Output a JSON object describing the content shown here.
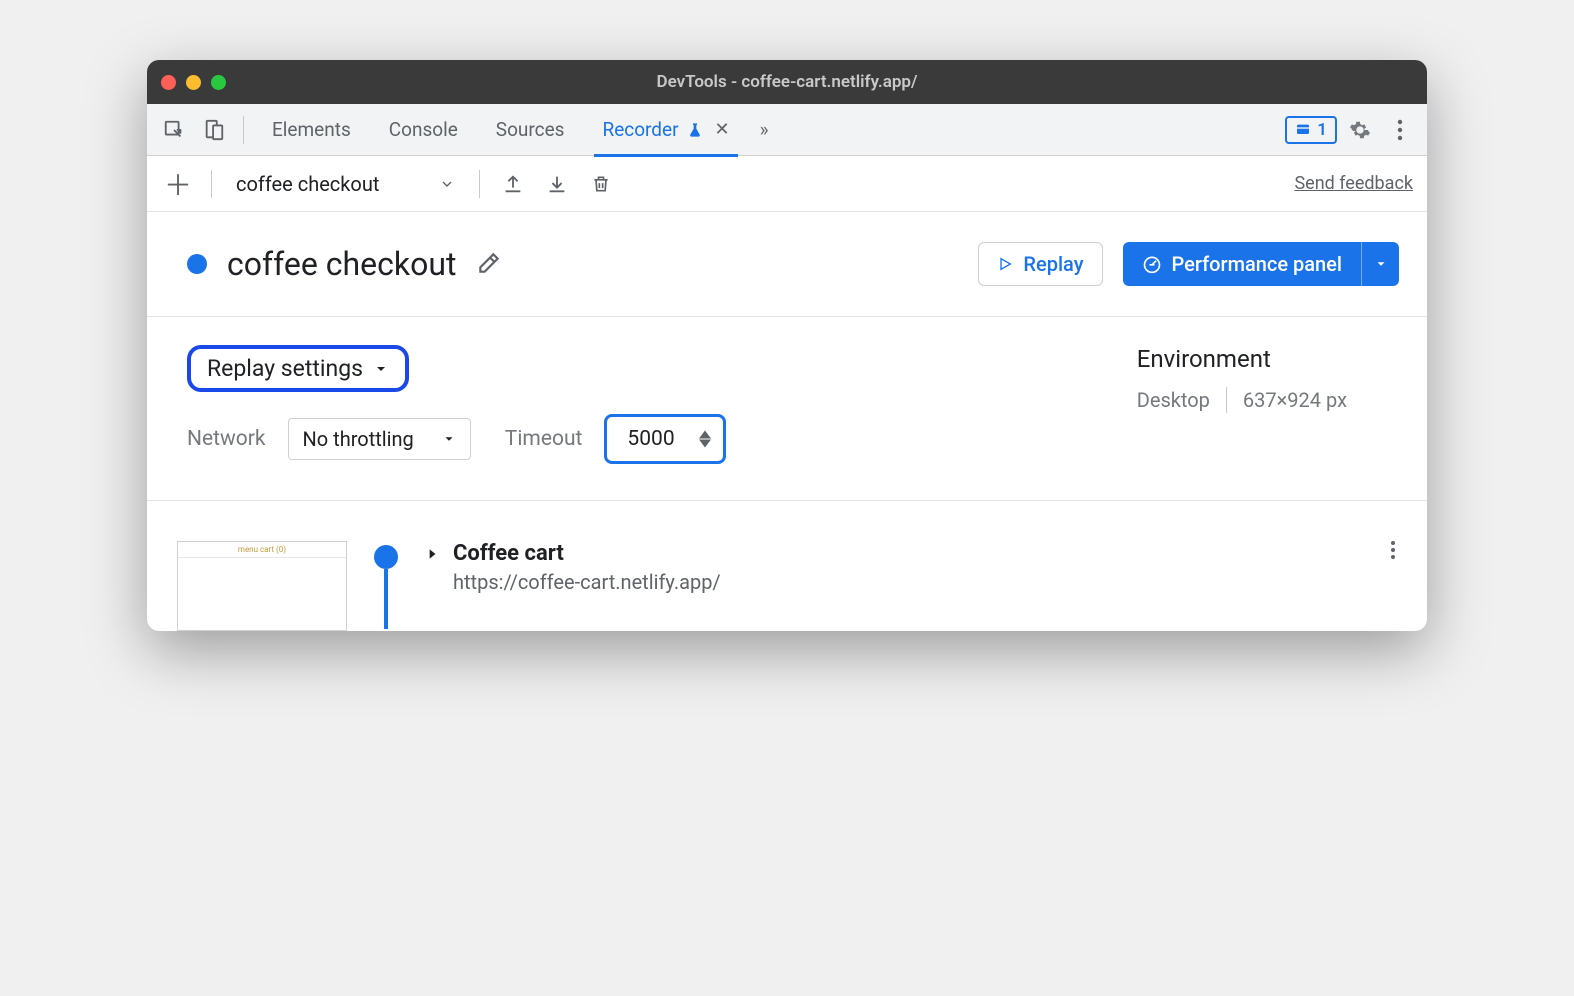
{
  "window": {
    "title": "DevTools - coffee-cart.netlify.app/"
  },
  "tabs": {
    "elements": "Elements",
    "console": "Console",
    "sources": "Sources",
    "recorder": "Recorder",
    "overflow": "»",
    "issues_count": "1"
  },
  "toolbar": {
    "recording_name": "coffee checkout",
    "send_feedback": "Send feedback"
  },
  "header": {
    "title": "coffee checkout",
    "replay_btn": "Replay",
    "perf_btn": "Performance panel"
  },
  "settings": {
    "replay_settings_label": "Replay settings",
    "network_label": "Network",
    "network_value": "No throttling",
    "timeout_label": "Timeout",
    "timeout_value": "5000",
    "env_label": "Environment",
    "env_device": "Desktop",
    "env_dims": "637×924 px"
  },
  "step": {
    "title": "Coffee cart",
    "url": "https://coffee-cart.netlify.app/",
    "thumb_text": "menu   cart (0)"
  }
}
